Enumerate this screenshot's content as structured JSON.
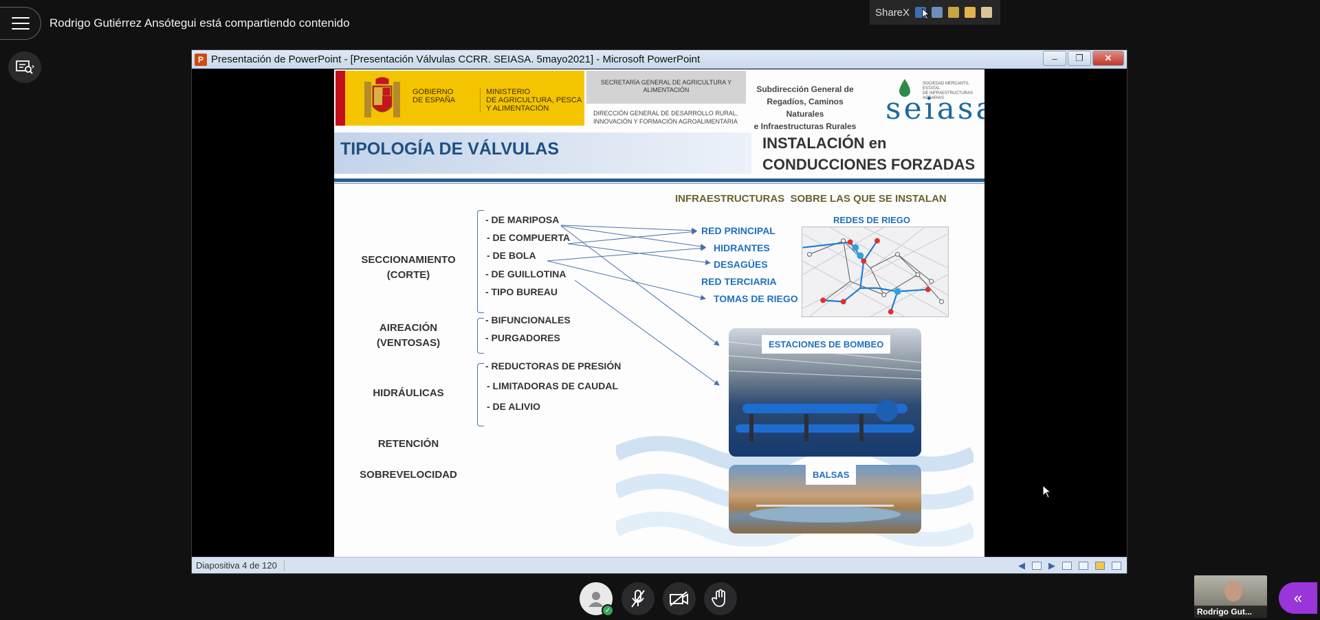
{
  "meeting": {
    "sharing_title": "Rodrigo Gutiérrez Ansótegui está compartiendo contenido",
    "participant_tile_name": "Rodrigo Gut..."
  },
  "sharex": {
    "label": "ShareX"
  },
  "powerpoint": {
    "window_title": "Presentación de PowerPoint - [Presentación Válvulas CCRR. SEIASA. 5mayo2021] - Microsoft PowerPoint",
    "status_slide": "Diapositiva 4 de 120"
  },
  "slide": {
    "gov": {
      "gobierno": "GOBIERNO\nDE ESPAÑA",
      "ministerio": "MINISTERIO\nDE AGRICULTURA, PESCA\nY ALIMENTACIÓN"
    },
    "secretaria": "SECRETARÍA GENERAL DE AGRICULTURA Y ALIMENTACIÓN",
    "direccion": "DIRECCIÓN GENERAL DE DESARROLLO RURAL,\nINNOVACIÓN Y FORMACIÓN AGROALIMENTARIA",
    "subdireccion": "Subdirección General de\nRegadíos, Caminos Naturales\ne Infraestructuras Rurales",
    "seiasa_small": "SOCIEDAD MERCANTIL ESTATAL\nDE INFRAESTRUCTURAS AGRARIAS",
    "seiasa_logo": "seiasa",
    "title": "TIPOLOGÍA DE VÁLVULAS",
    "install_title": "INSTALACIÓN en\nCONDUCCIONES FORZADAS",
    "infra_title": "INFRAESTRUCTURAS  SOBRE LAS QUE SE INSTALAN",
    "categories": {
      "seccionamiento": "SECCIONAMIENTO\n(CORTE)",
      "aireacion": "AIREACIÓN\n(VENTOSAS)",
      "hidraulicas": "HIDRÁULICAS",
      "retencion": "RETENCIÓN",
      "sobrevelocidad": "SOBREVELOCIDAD"
    },
    "items": {
      "mariposa": "- DE MARIPOSA",
      "compuerta": "- DE COMPUERTA",
      "bola": "- DE BOLA",
      "guillotina": "- DE GUILLOTINA",
      "bureau": "- TIPO BUREAU",
      "bifuncionales": "- BIFUNCIONALES",
      "purgadores": "- PURGADORES",
      "reductoras": "- REDUCTORAS DE PRESIÓN",
      "limitadoras": "- LIMITADORAS DE CAUDAL",
      "alivio": "- DE ALIVIO"
    },
    "targets": {
      "red_principal": "RED PRINCIPAL",
      "hidrantes": "HIDRANTES",
      "desagues": "DESAGÜES",
      "red_terciaria": "RED TERCIARIA",
      "tomas": "TOMAS DE RIEGO"
    },
    "redes_title": "REDES DE RIEGO",
    "estaciones_label": "ESTACIONES DE BOMBEO",
    "balsas_label": "BALSAS"
  },
  "icons": {
    "menu": "menu-icon",
    "search_share": "screen-search-icon",
    "me": "avatar-icon",
    "mic": "mic-off-icon",
    "camera": "camera-off-icon",
    "hand": "raise-hand-icon",
    "panel": "chevron-double-left-icon"
  },
  "colors": {
    "accent_purple": "#9a35d9",
    "slide_title_blue": "#1f4f82",
    "link_blue": "#1f6fbf"
  }
}
